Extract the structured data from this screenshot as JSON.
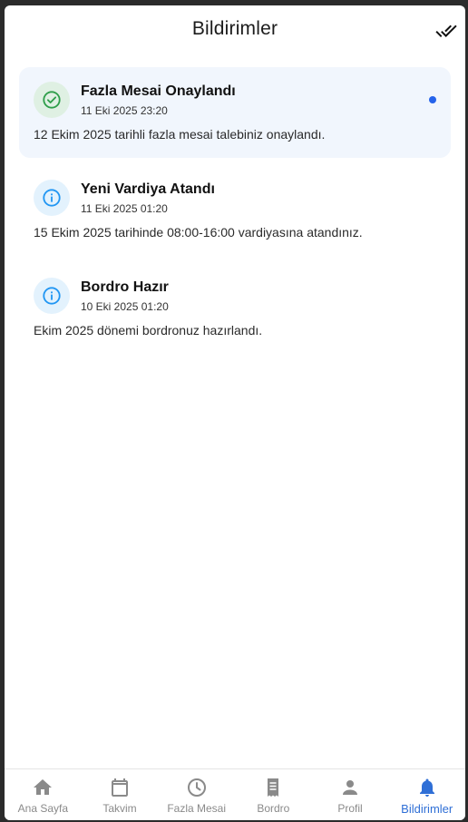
{
  "header": {
    "title": "Bildirimler",
    "mark_all_icon": "done-all-icon"
  },
  "colors": {
    "accent": "#2f6fd6",
    "success": "#2e9e4a",
    "info": "#2196f3",
    "unread_bg": "#f1f6fd"
  },
  "notifications": [
    {
      "title": "Fazla Mesai Onaylandı",
      "time": "11 Eki 2025 23:20",
      "body": "12 Ekim 2025 tarihli fazla mesai talebiniz onaylandı.",
      "icon": "check-circle-icon",
      "unread": true
    },
    {
      "title": "Yeni Vardiya Atandı",
      "time": "11 Eki 2025 01:20",
      "body": "15 Ekim 2025 tarihinde 08:00-16:00 vardiyasına atandınız.",
      "icon": "info-icon",
      "unread": false
    },
    {
      "title": "Bordro Hazır",
      "time": "10 Eki 2025 01:20",
      "body": "Ekim 2025 dönemi bordronuz hazırlandı.",
      "icon": "info-icon",
      "unread": false
    }
  ],
  "nav": {
    "items": [
      {
        "label": "Ana Sayfa",
        "icon": "home-icon"
      },
      {
        "label": "Takvim",
        "icon": "calendar-icon"
      },
      {
        "label": "Fazla Mesai",
        "icon": "clock-icon"
      },
      {
        "label": "Bordro",
        "icon": "receipt-icon"
      },
      {
        "label": "Profil",
        "icon": "person-icon"
      },
      {
        "label": "Bildirimler",
        "icon": "bell-icon"
      }
    ],
    "active": "Bildirimler"
  }
}
